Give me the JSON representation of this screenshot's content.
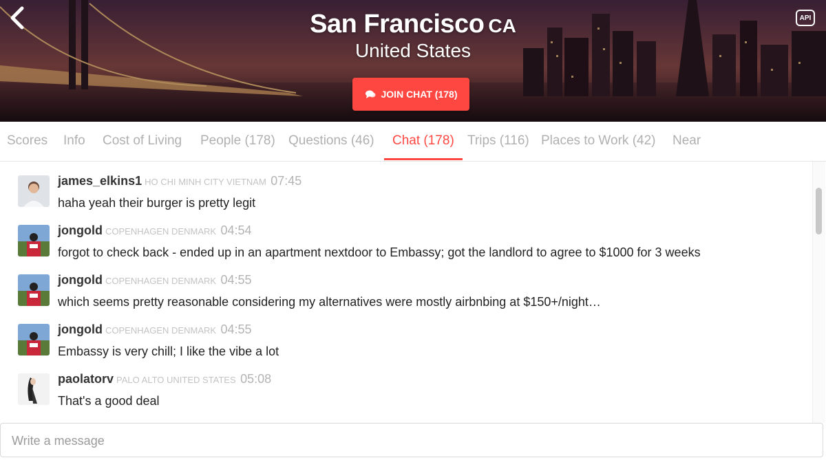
{
  "header": {
    "city": "San Francisco",
    "state": "CA",
    "country": "United States",
    "join_label": "JOIN CHAT (178)",
    "api_label": "API"
  },
  "tabs": [
    {
      "label": "Scores"
    },
    {
      "label": "Info"
    },
    {
      "label": "Cost of Living"
    },
    {
      "label": "People (178)"
    },
    {
      "label": "Questions (46)"
    },
    {
      "label": "Chat (178)"
    },
    {
      "label": "Trips (116)"
    },
    {
      "label": "Places to Work (42)"
    },
    {
      "label": "Near"
    }
  ],
  "messages": [
    {
      "user": "james_elkins1",
      "location": "HO CHI MINH CITY VIETNAM",
      "time": "07:45",
      "text": "haha yeah their burger is pretty legit"
    },
    {
      "user": "jongold",
      "location": "COPENHAGEN DENMARK",
      "time": "04:54",
      "text": "forgot to check back - ended up in an apartment nextdoor to Embassy; got the landlord to agree to $1000 for 3 weeks"
    },
    {
      "user": "jongold",
      "location": "COPENHAGEN DENMARK",
      "time": "04:55",
      "text": "which seems pretty reasonable considering my alternatives were mostly airbnbing at $150+/night…"
    },
    {
      "user": "jongold",
      "location": "COPENHAGEN DENMARK",
      "time": "04:55",
      "text": "Embassy is very chill; I like the vibe a lot"
    },
    {
      "user": "paolatorv",
      "location": "PALO ALTO UNITED STATES",
      "time": "05:08",
      "text": "That's a good deal"
    }
  ],
  "composer": {
    "placeholder": "Write a message"
  },
  "colors": {
    "accent": "#ff4742"
  }
}
